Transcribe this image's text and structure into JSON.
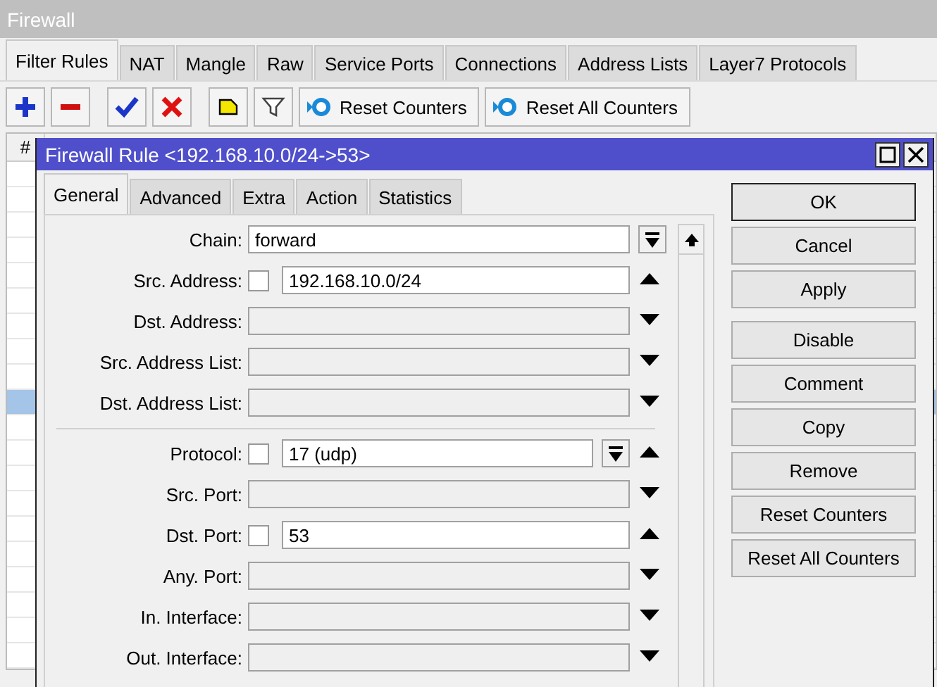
{
  "window": {
    "title": "Firewall"
  },
  "tabs": [
    {
      "label": "Filter Rules",
      "selected": true
    },
    {
      "label": "NAT",
      "selected": false
    },
    {
      "label": "Mangle",
      "selected": false
    },
    {
      "label": "Raw",
      "selected": false
    },
    {
      "label": "Service Ports",
      "selected": false
    },
    {
      "label": "Connections",
      "selected": false
    },
    {
      "label": "Address Lists",
      "selected": false
    },
    {
      "label": "Layer7 Protocols",
      "selected": false
    }
  ],
  "toolbar": {
    "buttons": [
      "Reset Counters",
      "Reset All Counters"
    ]
  },
  "table": {
    "columns": [
      "#"
    ],
    "rows": [
      {
        "selected": false
      },
      {
        "selected": false
      },
      {
        "selected": false
      },
      {
        "selected": false
      },
      {
        "selected": false
      },
      {
        "selected": false
      },
      {
        "selected": false
      },
      {
        "selected": false
      },
      {
        "selected": false
      },
      {
        "selected": true
      },
      {
        "selected": false
      },
      {
        "selected": false
      },
      {
        "selected": false
      },
      {
        "selected": false
      },
      {
        "selected": false
      },
      {
        "selected": false
      },
      {
        "selected": false
      },
      {
        "selected": false
      },
      {
        "selected": false
      },
      {
        "selected": false
      }
    ]
  },
  "dialog": {
    "title": "Firewall Rule <192.168.10.0/24->53>",
    "tabs": [
      {
        "label": "General",
        "selected": true
      },
      {
        "label": "Advanced",
        "selected": false
      },
      {
        "label": "Extra",
        "selected": false
      },
      {
        "label": "Action",
        "selected": false
      },
      {
        "label": "Statistics",
        "selected": false
      }
    ],
    "field_groups": [
      [
        {
          "label": "Chain:",
          "kind": "dropdown",
          "value": "forward"
        },
        {
          "label": "Src. Address:",
          "kind": "text",
          "value": "192.168.10.0/24",
          "negate_checked": false,
          "expanded": true
        },
        {
          "label": "Dst. Address:",
          "kind": "empty",
          "expanded": false
        },
        {
          "label": "Src. Address List:",
          "kind": "empty",
          "expanded": false
        },
        {
          "label": "Dst. Address List:",
          "kind": "empty",
          "expanded": false
        }
      ],
      [
        {
          "label": "Protocol:",
          "kind": "dropdown",
          "value": "17 (udp)",
          "negate_checked": false,
          "expanded": true
        },
        {
          "label": "Src. Port:",
          "kind": "empty",
          "expanded": false
        },
        {
          "label": "Dst. Port:",
          "kind": "text",
          "value": "53",
          "negate_checked": false,
          "expanded": true
        },
        {
          "label": "Any. Port:",
          "kind": "empty",
          "expanded": false
        },
        {
          "label": "In. Interface:",
          "kind": "empty",
          "expanded": false
        },
        {
          "label": "Out. Interface:",
          "kind": "empty",
          "expanded": false
        }
      ]
    ],
    "buttons": [
      {
        "label": "OK",
        "kind": "default"
      },
      {
        "label": "Cancel",
        "kind": "normal"
      },
      {
        "label": "Apply",
        "kind": "normal"
      },
      {
        "label": "Disable",
        "kind": "spaced"
      },
      {
        "label": "Comment",
        "kind": "normal"
      },
      {
        "label": "Copy",
        "kind": "normal"
      },
      {
        "label": "Remove",
        "kind": "normal"
      },
      {
        "label": "Reset Counters",
        "kind": "normal"
      },
      {
        "label": "Reset All Counters",
        "kind": "normal"
      }
    ]
  }
}
